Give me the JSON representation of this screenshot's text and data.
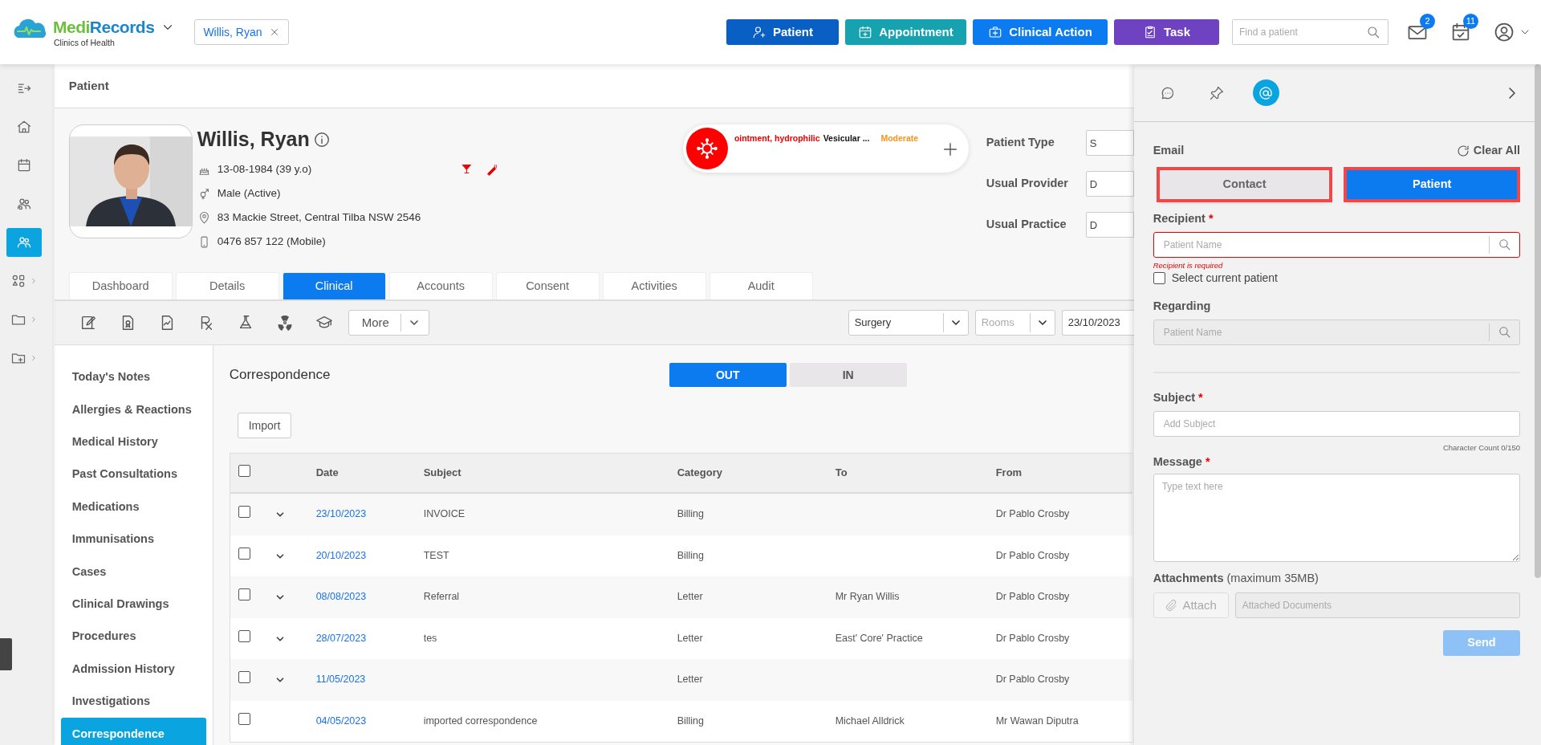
{
  "brand": {
    "name_parts": [
      "Medi",
      "Records"
    ],
    "subtitle": "Clinics of Health"
  },
  "open_patient_chip": {
    "label": "Willis, Ryan"
  },
  "header_buttons": [
    {
      "label": "Patient",
      "kind": "patient"
    },
    {
      "label": "Appointment",
      "kind": "appointment"
    },
    {
      "label": "Clinical Action",
      "kind": "clinical"
    },
    {
      "label": "Task",
      "kind": "task"
    }
  ],
  "search": {
    "placeholder": "Find a patient"
  },
  "notifications": [
    {
      "kind": "mail",
      "count": "2"
    },
    {
      "kind": "tasks",
      "count": "11"
    }
  ],
  "rail": [
    {
      "kind": "expand",
      "selected": false,
      "submenu": false
    },
    {
      "kind": "home",
      "selected": false,
      "submenu": false
    },
    {
      "kind": "calendar",
      "selected": false,
      "submenu": false
    },
    {
      "kind": "team",
      "selected": false,
      "submenu": false
    },
    {
      "kind": "patients",
      "selected": true,
      "submenu": false
    },
    {
      "kind": "apps",
      "selected": false,
      "submenu": true
    },
    {
      "kind": "folder",
      "selected": false,
      "submenu": true
    },
    {
      "kind": "folder-add",
      "selected": false,
      "submenu": true
    }
  ],
  "page_title": "Patient",
  "patient": {
    "name": "Willis, Ryan",
    "details": [
      {
        "kind": "dob",
        "text": "13-08-1984 (39 y.o)"
      },
      {
        "kind": "gender",
        "text": "Male (Active)"
      },
      {
        "kind": "address",
        "text": "83 Mackie Street, Central Tilba NSW 2546"
      },
      {
        "kind": "phone",
        "text": "0476 857 122 (Mobile)"
      }
    ]
  },
  "alert": {
    "substance": "ointment, hydrophilic",
    "reaction": "Vesicular ...",
    "severity": "Moderate"
  },
  "patient_fields": [
    {
      "label": "Patient Type",
      "value": "S"
    },
    {
      "label": "Usual Provider",
      "value": "D"
    },
    {
      "label": "Usual Practice",
      "value": "D"
    }
  ],
  "tabs": [
    {
      "label": "Dashboard",
      "selected": false
    },
    {
      "label": "Details",
      "selected": false
    },
    {
      "label": "Clinical",
      "selected": true
    },
    {
      "label": "Accounts",
      "selected": false
    },
    {
      "label": "Consent",
      "selected": false
    },
    {
      "label": "Activities",
      "selected": false
    },
    {
      "label": "Audit",
      "selected": false
    }
  ],
  "toolbar": {
    "more": "More",
    "selects": [
      {
        "kind": "select",
        "value": "Surgery"
      },
      {
        "kind": "select",
        "placeholder": "Rooms"
      },
      {
        "kind": "date",
        "value": "23/10/2023"
      }
    ]
  },
  "clinical_nav": [
    {
      "label": "Today's Notes",
      "selected": false
    },
    {
      "label": "Allergies & Reactions",
      "selected": false
    },
    {
      "label": "Medical History",
      "selected": false
    },
    {
      "label": "Past Consultations",
      "selected": false
    },
    {
      "label": "Medications",
      "selected": false
    },
    {
      "label": "Immunisations",
      "selected": false
    },
    {
      "label": "Cases",
      "selected": false
    },
    {
      "label": "Clinical Drawings",
      "selected": false
    },
    {
      "label": "Procedures",
      "selected": false
    },
    {
      "label": "Admission History",
      "selected": false
    },
    {
      "label": "Investigations",
      "selected": false
    },
    {
      "label": "Correspondence",
      "selected": true
    }
  ],
  "correspondence": {
    "title": "Correspondence",
    "direction": [
      {
        "label": "OUT",
        "selected": true
      },
      {
        "label": "IN",
        "selected": false
      }
    ],
    "import": "Import",
    "table": {
      "all_checked": false,
      "columns": [
        "Date",
        "Subject",
        "Category",
        "To",
        "From"
      ],
      "rows": [
        {
          "checked": false,
          "expandable": true,
          "date": "23/10/2023",
          "subject": "INVOICE",
          "category": "Billing",
          "from": "Dr Pablo Crosby"
        },
        {
          "checked": false,
          "expandable": true,
          "date": "20/10/2023",
          "subject": "TEST",
          "category": "Billing",
          "from": "Dr Pablo Crosby"
        },
        {
          "checked": false,
          "expandable": true,
          "date": "08/08/2023",
          "subject": "Referral",
          "category": "Letter",
          "to": "Mr Ryan Willis",
          "from": "Dr Pablo Crosby"
        },
        {
          "checked": false,
          "expandable": true,
          "date": "28/07/2023",
          "subject": "tes",
          "category": "Letter",
          "to": "East' Core' Practice",
          "from": "Dr Pablo Crosby"
        },
        {
          "checked": false,
          "expandable": true,
          "date": "11/05/2023",
          "category": "Letter",
          "from": "Dr Pablo Crosby"
        },
        {
          "checked": false,
          "expandable": false,
          "date": "04/05/2023",
          "subject": "imported correspondence",
          "category": "Billing",
          "to": "Michael Alldrick",
          "from": "Mr Wawan Diputra"
        }
      ]
    }
  },
  "panel": {
    "tools": [
      {
        "kind": "chat",
        "selected": false
      },
      {
        "kind": "pin",
        "selected": false
      },
      {
        "kind": "email",
        "selected": true
      }
    ],
    "title": "Email",
    "clear": "Clear All",
    "recipient_type": [
      {
        "label": "Contact",
        "selected": false,
        "highlighted": true
      },
      {
        "label": "Patient",
        "selected": true,
        "highlighted": true
      }
    ],
    "recipient": {
      "label": "Recipient",
      "required_mark": "*",
      "placeholder": "Patient Name",
      "error": "Recipient is required"
    },
    "select_current": {
      "label": "Select current patient",
      "checked": false
    },
    "regarding": {
      "label": "Regarding",
      "placeholder": "Patient Name",
      "disabled": true
    },
    "subject": {
      "label": "Subject",
      "required_mark": "*",
      "placeholder": "Add Subject",
      "counter": "Character Count 0/150"
    },
    "message": {
      "label": "Message",
      "required_mark": "*",
      "placeholder": "Type text here"
    },
    "attachments": {
      "label": "**Attachments** (maximum 35MB)",
      "button": "Attach",
      "placeholder": "Attached Documents",
      "disabled": true
    },
    "send": {
      "label": "Send",
      "disabled": true
    }
  }
}
